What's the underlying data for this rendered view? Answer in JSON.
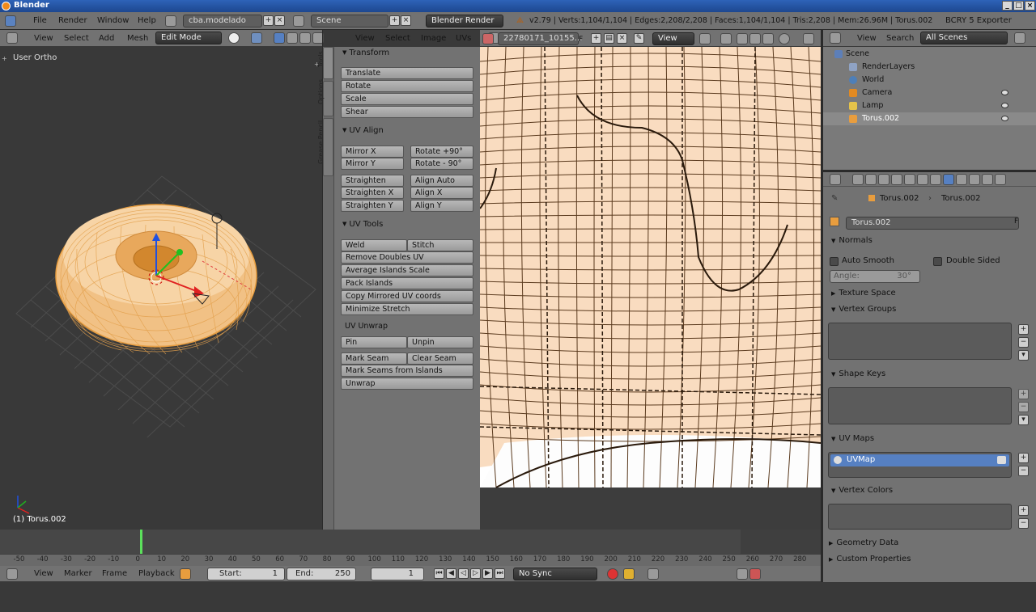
{
  "window": {
    "title": "Blender"
  },
  "infobar": {
    "menu": [
      "File",
      "Render",
      "Window",
      "Help"
    ],
    "screen": "cba.modelado",
    "scene": "Scene",
    "engine": "Blender Render",
    "stats": "v2.79 | Verts:1,104/1,104 | Edges:2,208/2,208 | Faces:1,104/1,104 | Tris:2,208 | Mem:26.96M | Torus.002",
    "exporter": "BCRY 5 Exporter"
  },
  "view3d": {
    "menu": [
      "View",
      "Select",
      "Add",
      "Mesh"
    ],
    "mode": "Edit Mode",
    "label": "User Ortho",
    "object_label": "(1) Torus.002"
  },
  "toolshelf": {
    "tabs": [
      "Tools",
      "Options",
      "Grease Pencil"
    ],
    "transform": {
      "title": "Transform",
      "buttons": [
        "Translate",
        "Rotate",
        "Scale",
        "Shear"
      ]
    },
    "uv_align": {
      "title": "UV Align",
      "mirror_x": "Mirror X",
      "rotate_p90": "Rotate +90°",
      "mirror_y": "Mirror Y",
      "rotate_m90": "Rotate - 90°",
      "straighten": "Straighten",
      "align_auto": "Align Auto",
      "straighten_x": "Straighten X",
      "align_x": "Align X",
      "straighten_y": "Straighten Y",
      "align_y": "Align Y"
    },
    "uv_tools": {
      "title": "UV Tools",
      "weld": "Weld",
      "stitch": "Stitch",
      "buttons": [
        "Remove Doubles UV",
        "Average Islands Scale",
        "Pack Islands",
        "Copy Mirrored UV coords",
        "Minimize Stretch"
      ],
      "unwrap_label": "UV Unwrap",
      "pin": "Pin",
      "unpin": "Unpin",
      "mark_seam": "Mark Seam",
      "clear_seam": "Clear Seam",
      "mark_seams_islands": "Mark Seams from Islands",
      "unwrap": "Unwrap"
    }
  },
  "uv_editor": {
    "menu": [
      "View",
      "Select",
      "Image",
      "UVs"
    ],
    "image_name": "22780171_10155...",
    "image_flag": "F",
    "view": "View"
  },
  "outliner": {
    "menu": [
      "View",
      "Search"
    ],
    "filter": "All Scenes",
    "items": [
      "Scene",
      "RenderLayers",
      "World",
      "Camera",
      "Lamp",
      "Torus.002"
    ]
  },
  "properties": {
    "breadcrumb": [
      "Torus.002",
      "Torus.002"
    ],
    "mesh_name": "Torus.002",
    "mesh_flag": "F",
    "normals": "Normals",
    "auto_smooth": "Auto Smooth",
    "double_sided": "Double Sided",
    "angle": "Angle:",
    "angle_value": "30°",
    "panels": [
      "Texture Space",
      "Vertex Groups",
      "Shape Keys",
      "UV Maps",
      "Vertex Colors",
      "Geometry Data",
      "Custom Properties"
    ],
    "uv_map": "UVMap"
  },
  "timeline": {
    "ticks": [
      "-50",
      "-40",
      "-30",
      "-20",
      "-10",
      "0",
      "10",
      "20",
      "30",
      "40",
      "50",
      "60",
      "70",
      "80",
      "90",
      "100",
      "110",
      "120",
      "130",
      "140",
      "150",
      "160",
      "170",
      "180",
      "190",
      "200",
      "210",
      "220",
      "230",
      "240",
      "250",
      "260",
      "270",
      "280"
    ],
    "menu": [
      "View",
      "Marker",
      "Frame",
      "Playback"
    ],
    "start_label": "Start:",
    "start": "1",
    "end_label": "End:",
    "end": "250",
    "current": "1",
    "sync": "No Sync"
  },
  "colors": {
    "selected_mesh": "#f5c07a",
    "uv_bg": "#f9dcc0",
    "highlight": "#5680c2"
  }
}
